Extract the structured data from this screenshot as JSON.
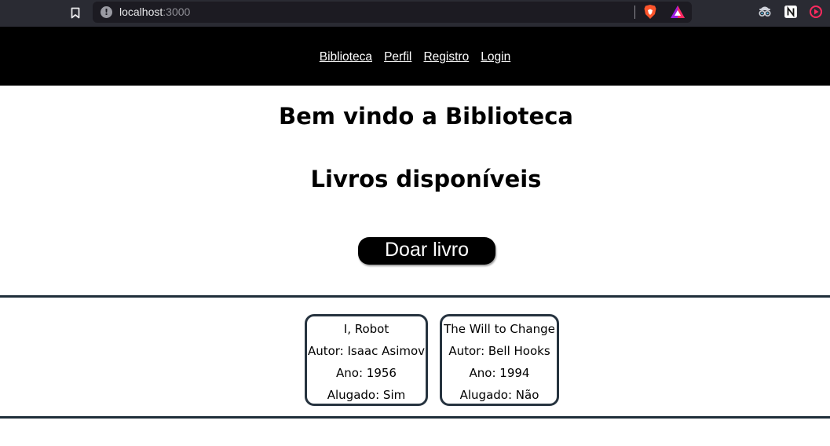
{
  "browser": {
    "url_host": "localhost",
    "url_port": ":3000",
    "icons": [
      "bookmark-icon",
      "info-icon",
      "brave-shield-icon",
      "brave-rewards-icon",
      "spy-extension-icon",
      "notion-extension-icon",
      "cast-extension-icon"
    ],
    "colors": {
      "chrome": "#2a2b33",
      "urlbar": "#1c1b22",
      "brave": "#fb542b",
      "notion": "#ffffff"
    }
  },
  "nav": {
    "items": [
      {
        "label": "Biblioteca"
      },
      {
        "label": "Perfil"
      },
      {
        "label": "Registro"
      },
      {
        "label": "Login"
      }
    ],
    "background": "#000000"
  },
  "main": {
    "title": "Bem vindo a Biblioteca",
    "subtitle": "Livros disponíveis",
    "donate_label": "Doar livro"
  },
  "books": [
    {
      "title": "I, Robot",
      "author": "Autor: Isaac Asimov",
      "year": "Ano: 1956",
      "rented": "Alugado: Sim"
    },
    {
      "title": "The Will to Change",
      "author": "Autor: Bell Hooks",
      "year": "Ano: 1994",
      "rented": "Alugado: Não"
    }
  ],
  "colors": {
    "card_border": "#26333f",
    "rule": "#1f2e3a"
  }
}
